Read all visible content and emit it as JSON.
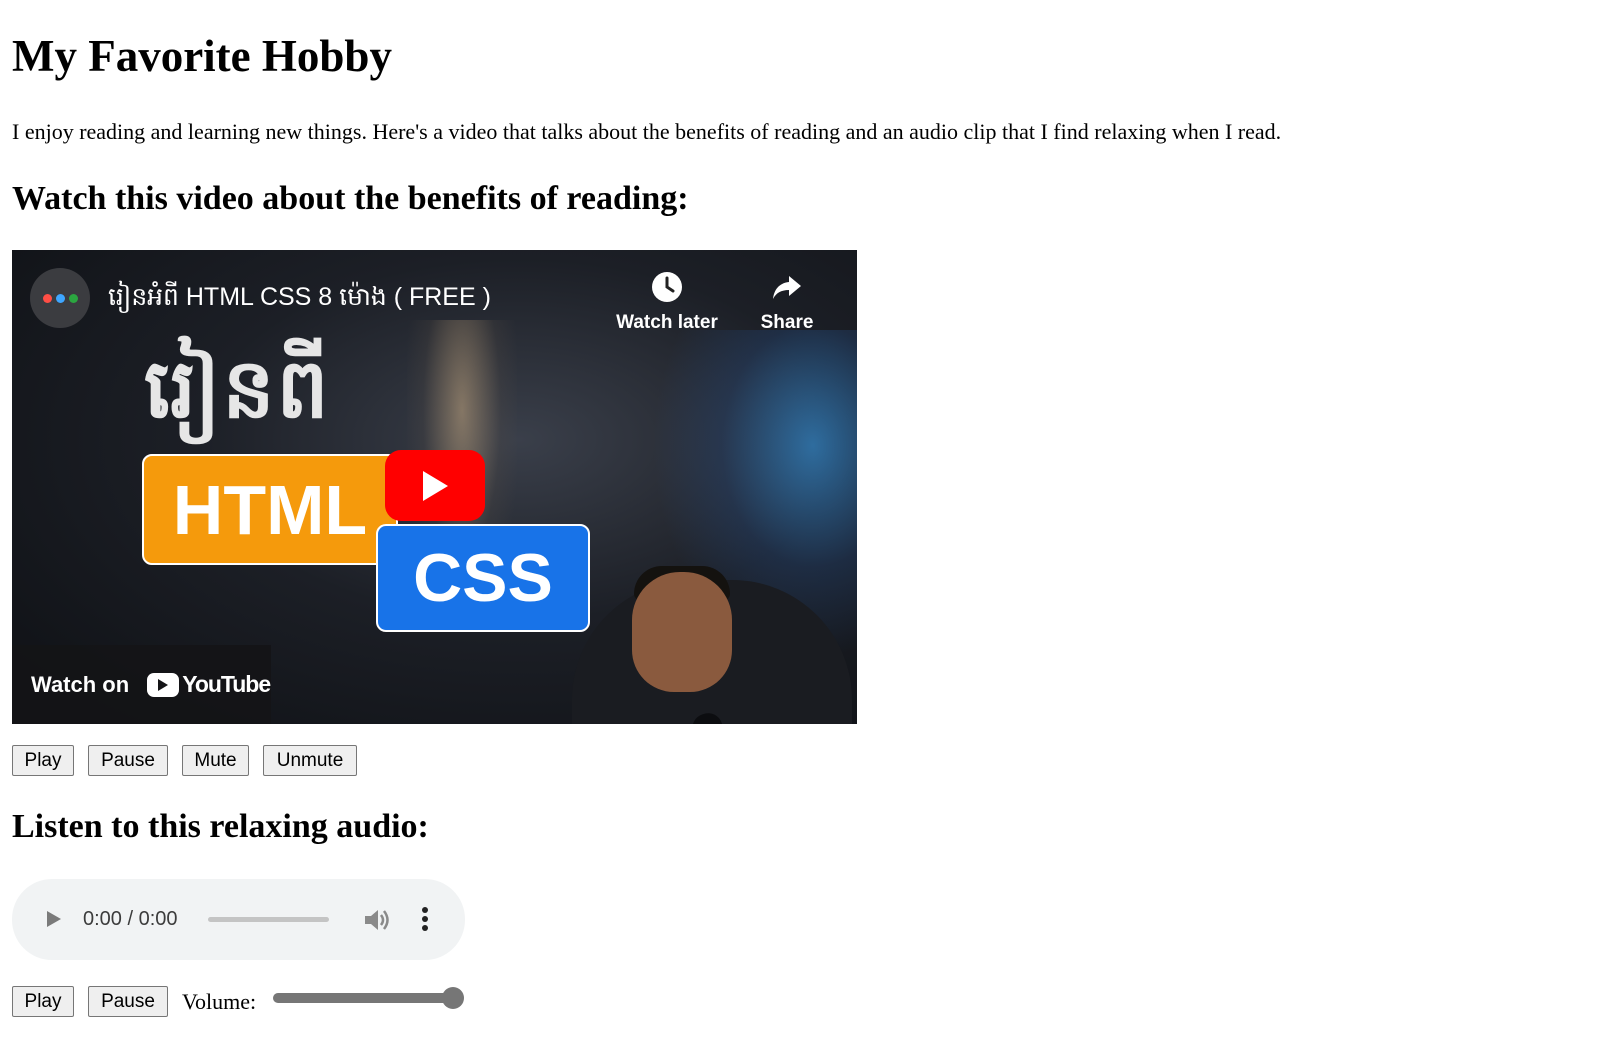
{
  "page": {
    "title": "My Favorite Hobby",
    "intro": "I enjoy reading and learning new things. Here's a video that talks about the benefits of reading and an audio clip that I find relaxing when I read.",
    "video_heading": "Watch this video about the benefits of reading:",
    "audio_heading": "Listen to this relaxing audio:"
  },
  "video": {
    "title": "រៀនអំពី HTML CSS 8 ម៉ោង ( FREE )",
    "thumbnail_text": "រៀនពី",
    "badge_html": "HTML",
    "badge_css": "CSS",
    "watch_later_label": "Watch later",
    "share_label": "Share",
    "watch_on_label": "Watch on",
    "youtube_wordmark": "YouTube",
    "channel_dot_colors": [
      "#ff4e45",
      "#3ea6ff",
      "#2ba640"
    ],
    "play_button_color": "#ff0000",
    "html_badge_color": "#f59a0c",
    "css_badge_color": "#1873e8"
  },
  "video_controls": {
    "play": "Play",
    "pause": "Pause",
    "mute": "Mute",
    "unmute": "Unmute"
  },
  "audio": {
    "time": "0:00 / 0:00",
    "progress": 0,
    "icons": [
      "play-icon",
      "volume-icon",
      "more-options-icon"
    ]
  },
  "audio_controls": {
    "play": "Play",
    "pause": "Pause",
    "volume_label": "Volume:",
    "volume_value": 1.0
  }
}
